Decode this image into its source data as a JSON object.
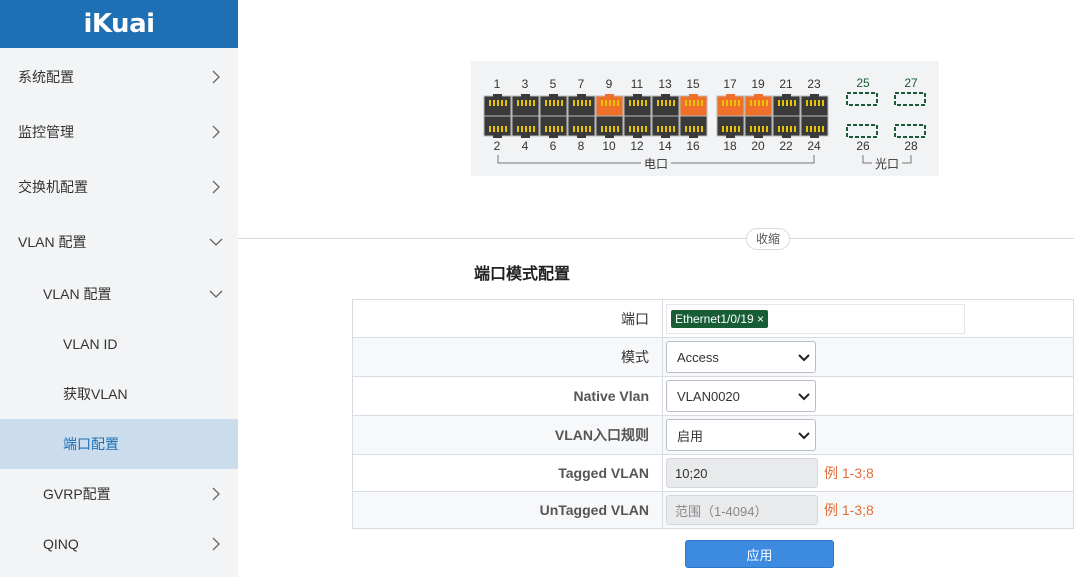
{
  "brand": {
    "logo_text": "iKuai",
    "color": "#1e6fb3"
  },
  "sidebar": {
    "items": [
      {
        "label": "系统配置",
        "chevron": "right"
      },
      {
        "label": "监控管理",
        "chevron": "right"
      },
      {
        "label": "交换机配置",
        "chevron": "right"
      },
      {
        "label": "VLAN 配置",
        "chevron": "down"
      },
      {
        "label": "VLAN 配置",
        "chevron": "down"
      },
      {
        "label": "VLAN ID",
        "chevron": ""
      },
      {
        "label": "获取VLAN",
        "chevron": ""
      },
      {
        "label": "端口配置",
        "chevron": "",
        "active": true
      },
      {
        "label": "GVRP配置",
        "chevron": "right"
      },
      {
        "label": "QINQ",
        "chevron": "right"
      }
    ]
  },
  "switch_panel": {
    "top_labels": [
      "1",
      "3",
      "5",
      "7",
      "9",
      "11",
      "13",
      "15",
      "17",
      "19",
      "21",
      "23"
    ],
    "bottom_labels": [
      "2",
      "4",
      "6",
      "8",
      "10",
      "12",
      "14",
      "16",
      "18",
      "20",
      "22",
      "24"
    ],
    "active_top_ports": [
      "9",
      "15",
      "17",
      "19"
    ],
    "electric_label": "电口",
    "sfp_top_labels": [
      "25",
      "27"
    ],
    "sfp_bottom_labels": [
      "26",
      "28"
    ],
    "optical_label": "光口",
    "port_color_active": "#f0702a",
    "port_color_inactive": "#3a3a3a",
    "port_pin_color": "#e8c20a"
  },
  "collapse_label": "收缩",
  "form": {
    "title": "端口模式配置",
    "port_label": "端口",
    "port_tag": "Ethernet1/0/19 ×",
    "mode_label": "模式",
    "mode_value": "Access",
    "native_vlan_label": "Native Vlan",
    "native_vlan_value": "VLAN0020",
    "ingress_label": "VLAN入口规则",
    "ingress_value": "启用",
    "tagged_label": "Tagged VLAN",
    "tagged_value": "10;20",
    "tagged_hint": "例 1-3;8",
    "untagged_label": "UnTagged VLAN",
    "untagged_placeholder": "范围（1-4094）",
    "untagged_hint": "例 1-3;8"
  },
  "apply_label": "应用"
}
